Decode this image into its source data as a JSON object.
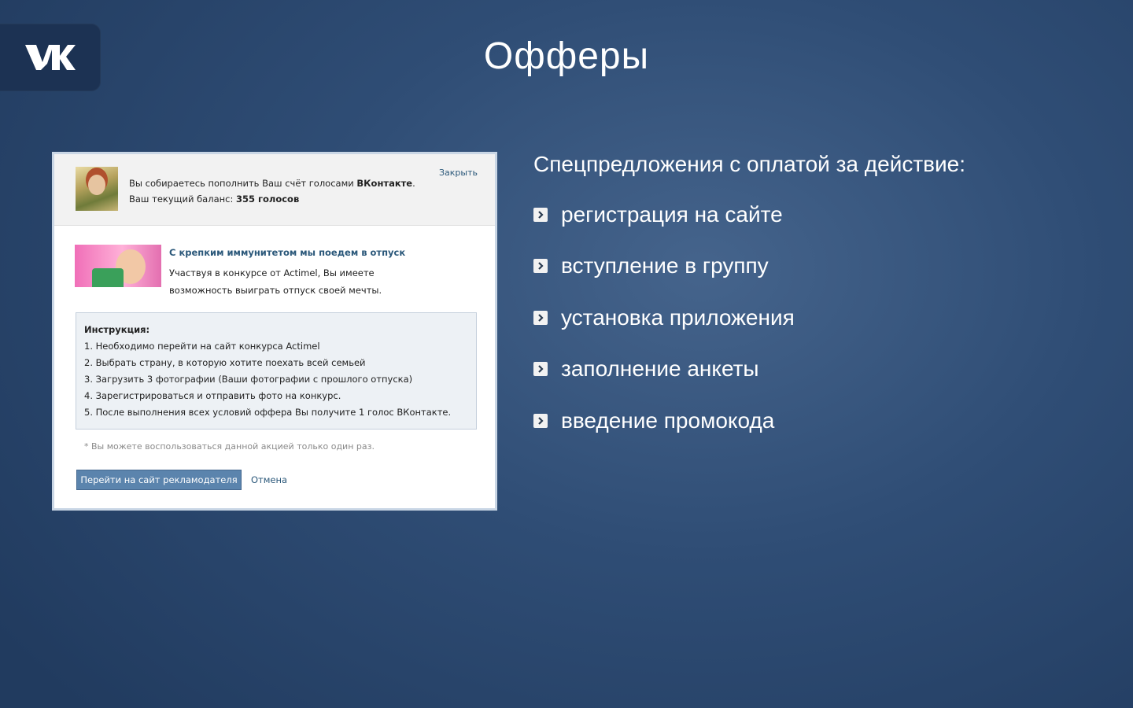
{
  "brand": {
    "logo_icon": "vk-logo-icon"
  },
  "slide": {
    "title": "Офферы"
  },
  "panel": {
    "header": {
      "line1_prefix": "Вы собираетесь пополнить Ваш счёт голосами ",
      "line1_brand": "ВКонтакте",
      "line1_suffix": ".",
      "line2_prefix": "Ваш текущий баланс: ",
      "line2_balance": "355 голосов",
      "close_label": "Закрыть"
    },
    "offer": {
      "title": "С крепким иммунитетом мы поедем в отпуск",
      "description": "Участвуя в конкурсе от Actimel, Вы имеете возможность выиграть отпуск своей мечты."
    },
    "instructions": {
      "title": "Инструкция:",
      "steps": [
        "1. Необходимо перейти на сайт конкурса Actimel",
        "2. Выбрать страну, в которую хотите поехать всей семьей",
        "3. Загрузить 3 фотографии (Ваши фотографии с прошлого отпуска)",
        "4. Зарегистрироваться и отправить фото на конкурс.",
        "5. После выполнения всех условий оффера Вы получите 1 голос ВКонтакте."
      ]
    },
    "note": "* Вы можете воспользоваться данной акцией только один раз.",
    "primary_button": "Перейти на сайт рекламодателя",
    "cancel_link": "Отмена"
  },
  "list": {
    "heading": "Спецпредложения с оплатой за действие:",
    "bullet_icon": "chevron-right-icon",
    "items": [
      "регистрация на сайте",
      "вступление в группу",
      "установка приложения",
      "заполнение анкеты",
      "введение промокода"
    ]
  },
  "colors": {
    "background": "#2f4d75",
    "logo_tab": "#1c3253",
    "link": "#2b587a",
    "button": "#5b84ad"
  }
}
